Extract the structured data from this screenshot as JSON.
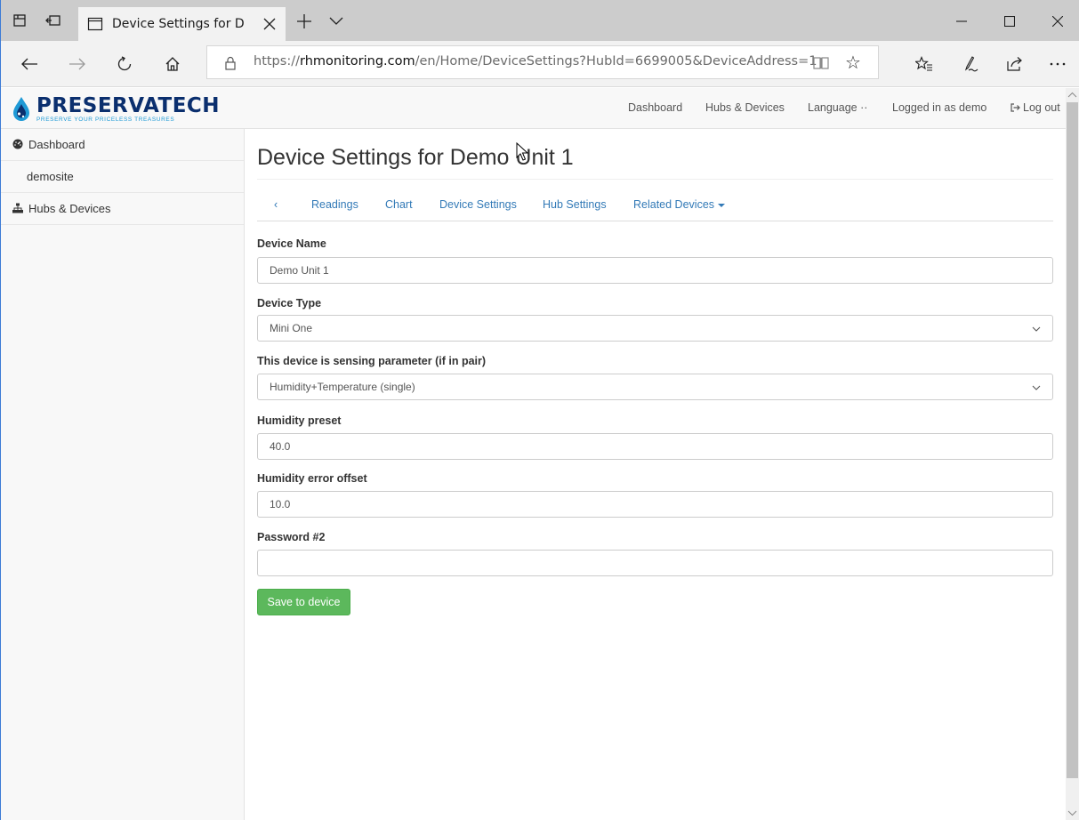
{
  "browser": {
    "tab_title": "Device Settings for Dem",
    "url_prefix": "https://",
    "url_host": "rhmonitoring.com",
    "url_path": "/en/Home/DeviceSettings?HubId=6699005&DeviceAddress=1"
  },
  "header": {
    "brand_name": "PRESERVATECH",
    "brand_tagline": "PRESERVE YOUR PRICELESS TREASURES",
    "nav": {
      "dashboard": "Dashboard",
      "hubs_devices": "Hubs & Devices",
      "language": "Language ··",
      "logged_in": "Logged in as demo",
      "logout": "Log out"
    }
  },
  "sidebar": {
    "items": [
      {
        "label": "Dashboard"
      },
      {
        "label": "demosite"
      },
      {
        "label": "Hubs & Devices"
      }
    ]
  },
  "main": {
    "title": "Device Settings for Demo Unit 1",
    "tabs": {
      "back": "‹",
      "readings": "Readings",
      "chart": "Chart",
      "device_settings": "Device Settings",
      "hub_settings": "Hub Settings",
      "related_devices": "Related Devices"
    },
    "form": {
      "device_name_label": "Device Name",
      "device_name_value": "Demo Unit 1",
      "device_type_label": "Device Type",
      "device_type_value": "Mini One",
      "sensing_label": "This device is sensing parameter (if in pair)",
      "sensing_value": "Humidity+Temperature (single)",
      "humidity_preset_label": "Humidity preset",
      "humidity_preset_value": "40.0",
      "humidity_offset_label": "Humidity error offset",
      "humidity_offset_value": "10.0",
      "password2_label": "Password #2",
      "password2_value": "",
      "save_label": "Save to device"
    }
  },
  "colors": {
    "link": "#337ab7",
    "success": "#5cb85c",
    "brand_navy": "#0b2f6e",
    "brand_blue": "#1f9ad6"
  }
}
